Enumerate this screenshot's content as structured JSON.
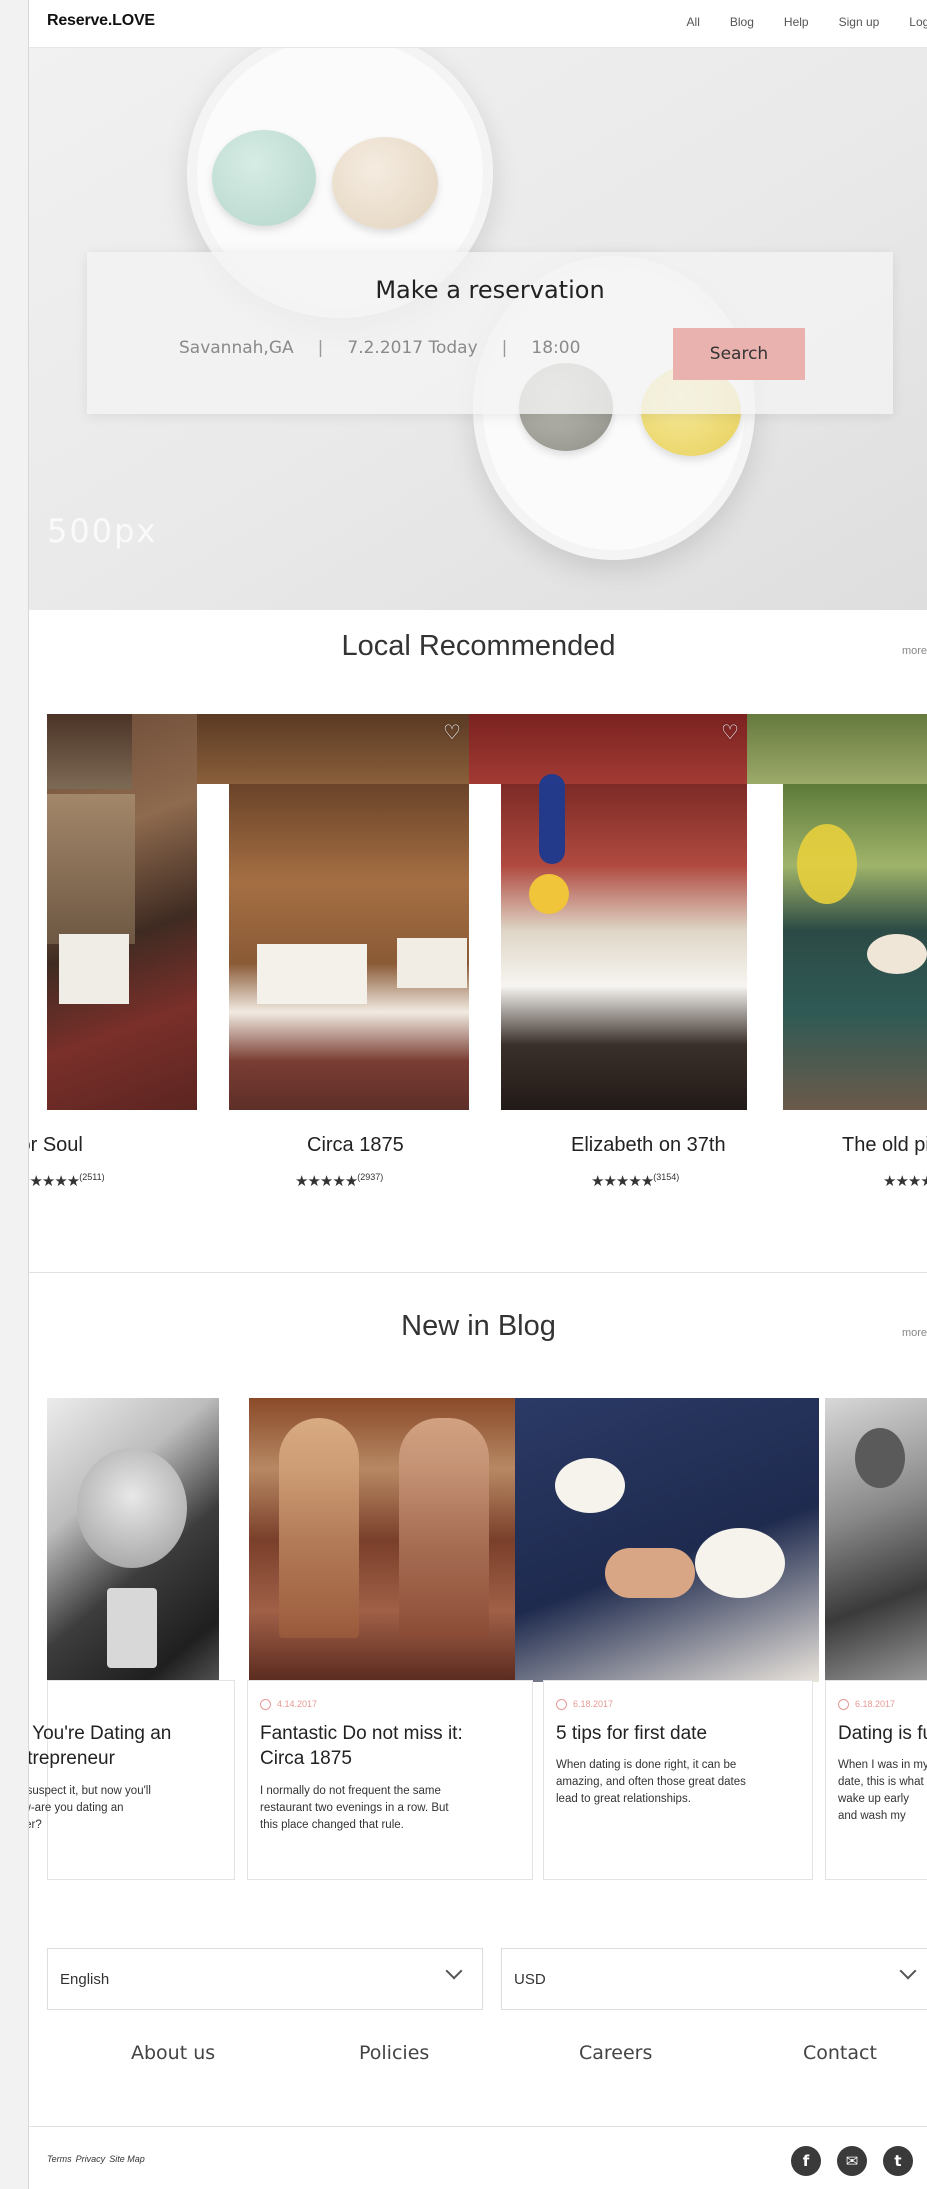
{
  "brand": "Reserve.LOVE",
  "nav": [
    "All",
    "Blog",
    "Help",
    "Sign up",
    "Log in"
  ],
  "hero": {
    "title": "Make a reservation",
    "location": "Savannah,GA",
    "date": "7.2.2017 Today",
    "time": "18:00",
    "search_label": "Search",
    "watermark": "500px"
  },
  "recommended": {
    "title": "Local Recommended",
    "more": "more",
    "items": [
      {
        "name": "Alligator Soul",
        "stars": "★★★★★",
        "count": "(2511)"
      },
      {
        "name": "Circa 1875",
        "stars": "★★★★★",
        "count": "(2937)"
      },
      {
        "name": "Elizabeth on 37th",
        "stars": "★★★★★",
        "count": "(3154)"
      },
      {
        "name": "The old pink",
        "stars": "★★★★★",
        "count": ""
      }
    ]
  },
  "blog": {
    "title": "New in Blog",
    "more": "more",
    "posts": [
      {
        "date": "",
        "title_lines": [
          "So You're Dating an",
          "Entrepreneur"
        ],
        "text": [
          "You suspect it, but now you'll",
          "know-are you dating an",
          "owner?"
        ]
      },
      {
        "date": "4.14.2017",
        "title_lines": [
          "Fantastic Do not miss it:",
          "Circa 1875"
        ],
        "text": [
          "I normally do not frequent the same",
          "restaurant two evenings in a row. But",
          "this place changed that rule."
        ]
      },
      {
        "date": "6.18.2017",
        "title_lines": [
          "5 tips for first date",
          ""
        ],
        "text": [
          "When dating is done right, it can be",
          "amazing, and often those great dates",
          "lead to great relationships."
        ]
      },
      {
        "date": "6.18.2017",
        "title_lines": [
          "Dating is fun",
          ""
        ],
        "text": [
          "When I was in my first",
          "date, this is what I",
          "wake up early",
          "and wash my"
        ]
      }
    ]
  },
  "footer": {
    "language": "English",
    "currency": "USD",
    "links": [
      "About us",
      "Policies",
      "Careers",
      "Contact"
    ],
    "legal": [
      "Terms",
      "Privacy",
      "Site Map"
    ],
    "social": [
      "f",
      "✉",
      "t"
    ]
  }
}
